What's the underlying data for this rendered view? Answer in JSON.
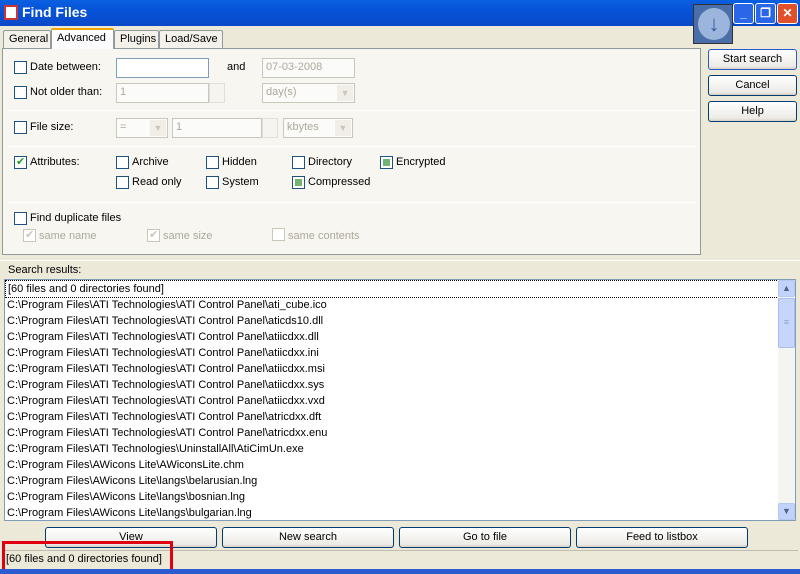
{
  "window": {
    "title": "Find Files"
  },
  "tabs": [
    {
      "label": "General"
    },
    {
      "label": "Advanced"
    },
    {
      "label": "Plugins"
    },
    {
      "label": "Load/Save"
    }
  ],
  "advanced": {
    "date_between": {
      "label": "Date between:",
      "checked": false,
      "from": "",
      "and_label": "and",
      "to": "07-03-2008"
    },
    "not_older": {
      "label": "Not older than:",
      "checked": false,
      "value": "1",
      "unit": "day(s)"
    },
    "file_size": {
      "label": "File size:",
      "checked": false,
      "operator": "=",
      "value": "1",
      "unit": "kbytes"
    },
    "attributes": {
      "label": "Attributes:",
      "checked": true,
      "items": [
        {
          "label": "Archive",
          "state": "unchecked"
        },
        {
          "label": "Hidden",
          "state": "unchecked"
        },
        {
          "label": "Directory",
          "state": "unchecked"
        },
        {
          "label": "Encrypted",
          "state": "indeterminate"
        },
        {
          "label": "Read only",
          "state": "unchecked"
        },
        {
          "label": "System",
          "state": "unchecked"
        },
        {
          "label": "Compressed",
          "state": "indeterminate"
        }
      ]
    },
    "duplicates": {
      "label": "Find duplicate files",
      "checked": false,
      "same_name": "same name",
      "same_size": "same size",
      "same_contents": "same contents"
    }
  },
  "side_buttons": {
    "start": "Start search",
    "cancel": "Cancel",
    "help": "Help"
  },
  "results": {
    "label": "Search results:",
    "rows": [
      "[60 files and 0 directories found]",
      "C:\\Program Files\\ATI Technologies\\ATI Control Panel\\ati_cube.ico",
      "C:\\Program Files\\ATI Technologies\\ATI Control Panel\\aticds10.dll",
      "C:\\Program Files\\ATI Technologies\\ATI Control Panel\\atiicdxx.dll",
      "C:\\Program Files\\ATI Technologies\\ATI Control Panel\\atiicdxx.ini",
      "C:\\Program Files\\ATI Technologies\\ATI Control Panel\\atiicdxx.msi",
      "C:\\Program Files\\ATI Technologies\\ATI Control Panel\\atiicdxx.sys",
      "C:\\Program Files\\ATI Technologies\\ATI Control Panel\\atiicdxx.vxd",
      "C:\\Program Files\\ATI Technologies\\ATI Control Panel\\atricdxx.dft",
      "C:\\Program Files\\ATI Technologies\\ATI Control Panel\\atricdxx.enu",
      "C:\\Program Files\\ATI Technologies\\UninstallAll\\AtiCimUn.exe",
      "C:\\Program Files\\AWicons Lite\\AWiconsLite.chm",
      "C:\\Program Files\\AWicons Lite\\langs\\belarusian.lng",
      "C:\\Program Files\\AWicons Lite\\langs\\bosnian.lng",
      "C:\\Program Files\\AWicons Lite\\langs\\bulgarian.lng"
    ]
  },
  "bottom_buttons": {
    "view": "View",
    "new_search": "New search",
    "go_to_file": "Go to file",
    "feed": "Feed to listbox"
  },
  "status": "[60 files and 0 directories found]",
  "highlight_color": "#e00010"
}
